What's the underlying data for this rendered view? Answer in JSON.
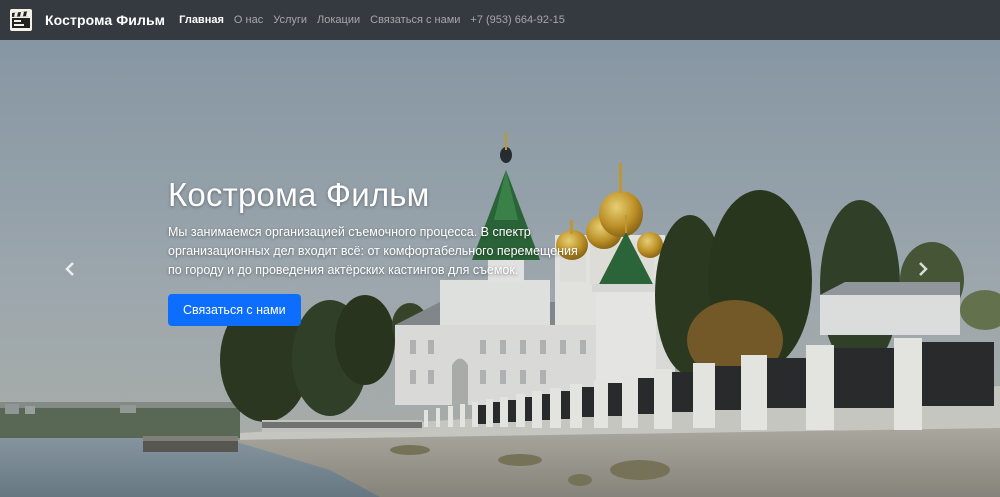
{
  "navbar": {
    "brand": "Кострома Фильм",
    "logo_icon": "film-clapperboard-icon",
    "links": [
      {
        "label": "Главная",
        "active": true
      },
      {
        "label": "О нас",
        "active": false
      },
      {
        "label": "Услуги",
        "active": false
      },
      {
        "label": "Локации",
        "active": false
      },
      {
        "label": "Связаться с нами",
        "active": false
      },
      {
        "label": "+7 (953) 664-92-15",
        "active": false
      }
    ]
  },
  "hero": {
    "title": "Кострома Фильм",
    "text": "Мы занимаемся организацией съемочного процесса. В спектр организационных дел входит всё: от комфортабельного перемещения по городу и до проведения актёрских кастингов для съемок.",
    "button": "Связаться с нами",
    "prev_icon": "chevron-left-icon",
    "next_icon": "chevron-right-icon"
  },
  "colors": {
    "navbar_bg": "#343a40",
    "accent": "#0d6efd"
  }
}
